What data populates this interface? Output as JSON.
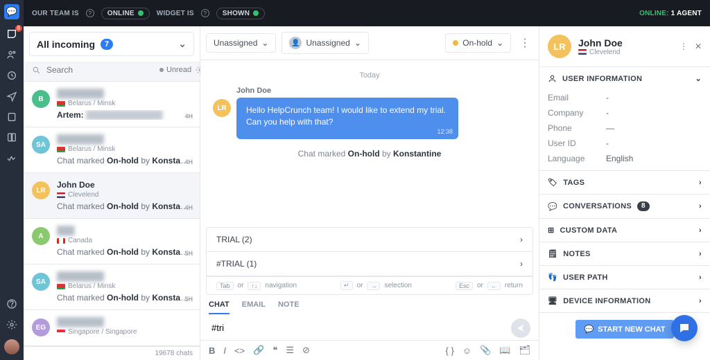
{
  "topbar": {
    "team_label": "OUR TEAM IS",
    "team_state": "ONLINE",
    "widget_label": "WIDGET IS",
    "widget_state": "SHOWN",
    "online_label": "ONLINE:",
    "agent_count": "1 AGENT"
  },
  "rail": {
    "inbox_badge": "8"
  },
  "inbox": {
    "filter_label": "All incoming",
    "filter_count": "7",
    "search_placeholder": "Search",
    "unread_label": "Unread",
    "totals": "19678 chats",
    "items": [
      {
        "initials": "B",
        "avatar_color": "#4bbf8b",
        "name": "████████",
        "blur": true,
        "flag": "by",
        "loc": "Belarus / Minsk",
        "preview_prefix": "Artem:",
        "preview_blur": true,
        "age": "4H"
      },
      {
        "initials": "SA",
        "avatar_color": "#6fc5d6",
        "name": "████████",
        "blur": true,
        "flag": "by",
        "loc": "Belarus / Minsk",
        "preview": "Chat marked <b>On-hold</b> by <b>Konstantine</b>",
        "age": "4H"
      },
      {
        "initials": "LR",
        "avatar_color": "#f3c25d",
        "name": "John Doe",
        "blur": false,
        "flag": "us",
        "loc": "Clevelend",
        "preview": "Chat marked <b>On-hold</b> by <b>Konstantine</b>",
        "age": "4H",
        "selected": true
      },
      {
        "initials": "A",
        "avatar_color": "#8ac96e",
        "name": "███",
        "blur": true,
        "flag": "ca",
        "loc": "Canada",
        "preview": "Chat marked <b>On-hold</b> by <b>Konstantine</b>",
        "age": "5H"
      },
      {
        "initials": "SA",
        "avatar_color": "#6fc5d6",
        "name": "████████",
        "blur": true,
        "flag": "by",
        "loc": "Belarus / Minsk",
        "preview": "Chat marked <b>On-hold</b> by <b>Konstantine</b>",
        "age": "5H"
      },
      {
        "initials": "EG",
        "avatar_color": "#b49bdc",
        "name": "████████",
        "blur": true,
        "flag": "sg",
        "loc": "Singapore / Singapore",
        "preview": "",
        "age": ""
      }
    ]
  },
  "mainbar": {
    "assign_team": "Unassigned",
    "assign_agent": "Unassigned",
    "status": "On-hold"
  },
  "chat": {
    "day": "Today",
    "sender": "John Doe",
    "av_initials": "LR",
    "bubble": "Hello HelpCrunch team! I would like to extend my trial. Can you help with that?",
    "time": "12:38",
    "system_prefix": "Chat marked ",
    "system_status": "On-hold",
    "system_mid": " by ",
    "system_agent": "Konstantine"
  },
  "suggest": {
    "rows": [
      "TRIAL (2)",
      "#TRIAL (1)"
    ],
    "hint_tab": "Tab",
    "hint_nav_or": "or",
    "hint_nav": "navigation",
    "hint_sel": "selection",
    "hint_esc": "Esc",
    "hint_ret": "return"
  },
  "composer": {
    "tabs": [
      "CHAT",
      "EMAIL",
      "NOTE"
    ],
    "active": 0,
    "draft": "#tri"
  },
  "side": {
    "name": "John Doe",
    "initials": "LR",
    "loc": "Clevelend",
    "info_title": "USER INFORMATION",
    "fields": [
      {
        "k": "Email",
        "v": "-"
      },
      {
        "k": "Company",
        "v": "-"
      },
      {
        "k": "Phone",
        "v": "—"
      },
      {
        "k": "User ID",
        "v": "-"
      },
      {
        "k": "Language",
        "v": "English"
      }
    ],
    "sections": [
      {
        "icon": "tag",
        "label": "TAGS"
      },
      {
        "icon": "chat",
        "label": "CONVERSATIONS",
        "badge": "8"
      },
      {
        "icon": "data",
        "label": "CUSTOM DATA"
      },
      {
        "icon": "note",
        "label": "NOTES"
      },
      {
        "icon": "path",
        "label": "USER PATH"
      },
      {
        "icon": "device",
        "label": "DEVICE INFORMATION"
      }
    ],
    "start_btn": "START NEW CHAT"
  }
}
